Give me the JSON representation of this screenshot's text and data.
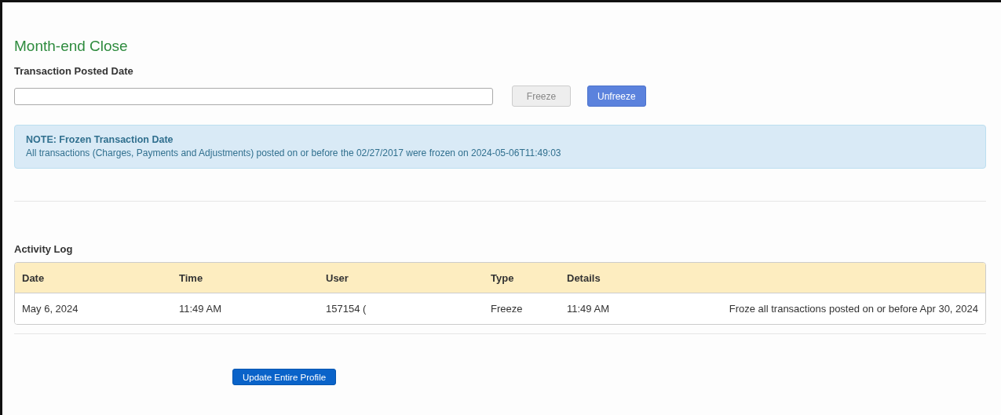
{
  "title": "Month-end Close",
  "date_field": {
    "label": "Transaction Posted Date"
  },
  "buttons": [
    {
      "label": "Freeze",
      "disabled": true
    },
    {
      "label": "Unfreeze",
      "disabled": false
    }
  ],
  "note": {
    "heading": "NOTE: Frozen Transaction Date",
    "text": "All transactions (Charges, Payments and Adjustments) posted on or before the 02/27/2017 were frozen on 2024-05-06T11:49:03"
  },
  "activity_log": {
    "title": "Activity Log",
    "columns": [
      "Date",
      "Time",
      "User",
      "Type",
      "Details"
    ],
    "rows": [
      {
        "cells": [
          "May 6, 2024",
          "11:49 AM",
          "157154 (",
          "Freeze",
          "11:49 AM",
          "Froze all transactions posted on or before Apr 30, 2024"
        ]
      }
    ]
  },
  "update_button": "Update Entire Profile"
}
